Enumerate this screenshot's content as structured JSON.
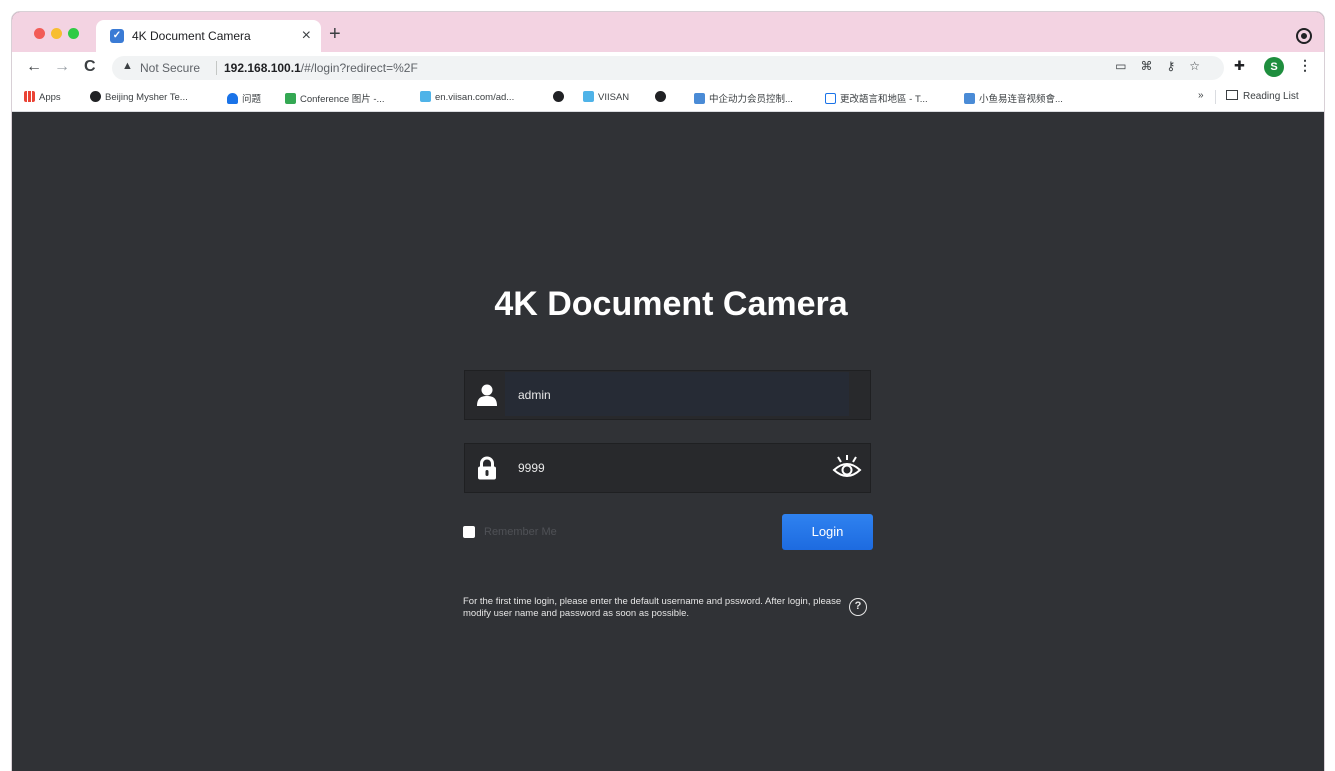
{
  "browser": {
    "tab": {
      "title": "4K Document Camera",
      "close": "×"
    },
    "new_tab": "+",
    "nav": {
      "back": "←",
      "forward": "→",
      "reload": "C"
    },
    "address": {
      "security_label": "Not Secure",
      "url_host": "192.168.100.1",
      "url_path": "/#/login?redirect=%2F"
    },
    "profile_initial": "S",
    "bookmarks": [
      {
        "label": "Apps",
        "icon": "apps-grid-icon"
      },
      {
        "label": "Beijing Mysher Te...",
        "icon": "globe-icon"
      },
      {
        "label": "问题",
        "icon": "ribbon-icon"
      },
      {
        "label": "Conference 图片 -...",
        "icon": "image-icon"
      },
      {
        "label": "en.viisan.com/ad...",
        "icon": "site-icon"
      },
      {
        "label": "",
        "icon": "globe-icon"
      },
      {
        "label": "VIISAN",
        "icon": "site-icon"
      },
      {
        "label": "",
        "icon": "globe-icon"
      },
      {
        "label": "中企动力会员控制...",
        "icon": "site-icon"
      },
      {
        "label": "更改語言和地區 - T...",
        "icon": "window-icon"
      },
      {
        "label": "小鱼易连音视频會...",
        "icon": "link-icon"
      }
    ],
    "bookmarks_overflow": "»",
    "reading_list": "Reading List"
  },
  "login": {
    "title": "4K Document Camera",
    "username_value": "admin",
    "password_value": "9999",
    "remember_label": "Remember Me",
    "login_label": "Login",
    "hint": "For the first time login, please enter the default username and pssword. After login, please modify user name and password as soon as possible.",
    "help_glyph": "?"
  },
  "colors": {
    "page_background": "#303236",
    "button_blue": "#1d6be0",
    "tab_strip": "#f3d3e2"
  }
}
